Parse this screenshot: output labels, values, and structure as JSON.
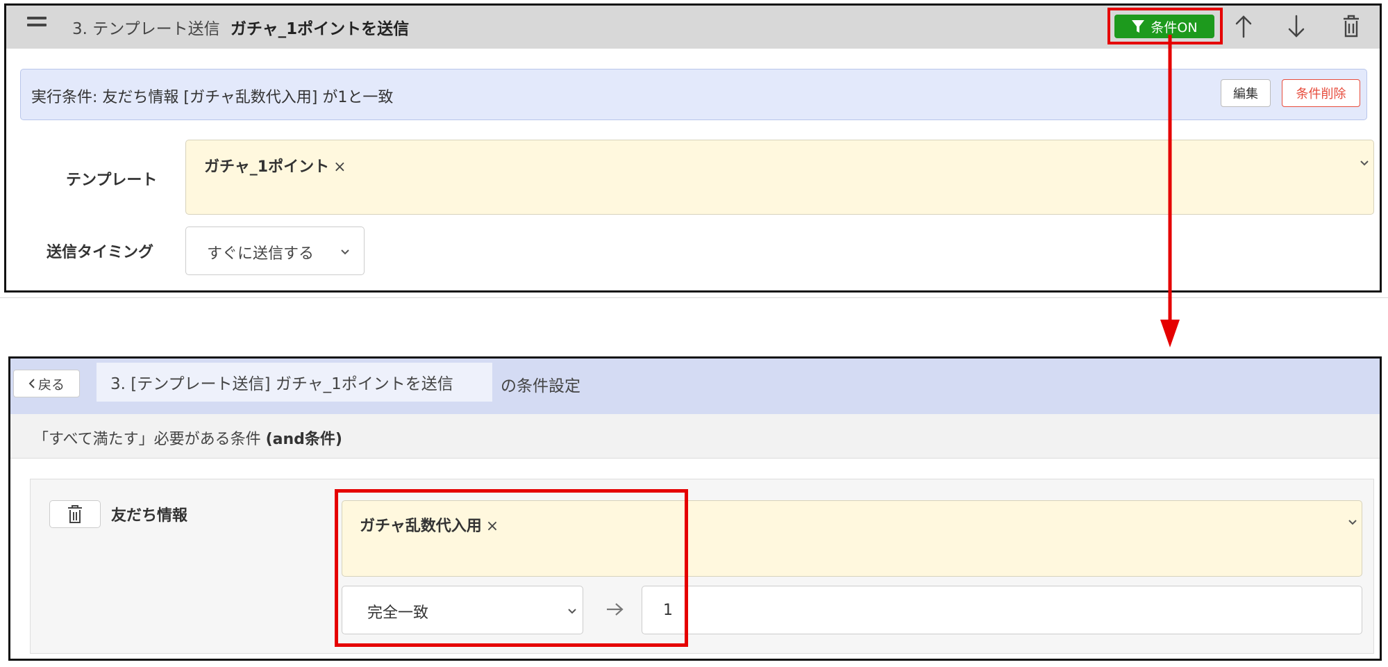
{
  "top_step": {
    "number": "3.",
    "action": "テンプレート送信",
    "name": "ガチャ_1ポイントを送信",
    "condition_button": "条件ON"
  },
  "condition_bar": {
    "text": "実行条件: 友だち情報 [ガチャ乱数代入用] が1と一致",
    "edit_label": "編集",
    "delete_label": "条件削除"
  },
  "template_row": {
    "label": "テンプレート",
    "selected_tag": "ガチャ_1ポイント",
    "remove_glyph": "×"
  },
  "timing_row": {
    "label": "送信タイミング",
    "value": "すぐに送信する"
  },
  "condition_editor": {
    "back_label": "戻る",
    "target": "3. [テンプレート送信] ガチャ_1ポイントを送信",
    "suffix": "の条件設定",
    "group_prefix": "「すべて満たす」必要がある条件 ",
    "group_type": "(and条件)",
    "condition": {
      "type_label": "友だち情報",
      "field_tag": "ガチャ乱数代入用",
      "remove_glyph": "×",
      "operator": "完全一致",
      "value": "1"
    }
  },
  "colors": {
    "accent_green": "#1d9a1d",
    "highlight_red": "#e50000",
    "condition_bar_bg": "#e3e9fb",
    "tag_field_bg": "#fff8de"
  },
  "icons": [
    "hamburger-icon",
    "filter-icon",
    "arrow-up-icon",
    "arrow-down-icon",
    "trash-icon",
    "chevron-down-icon",
    "chevron-left-icon",
    "arrow-right-icon"
  ]
}
